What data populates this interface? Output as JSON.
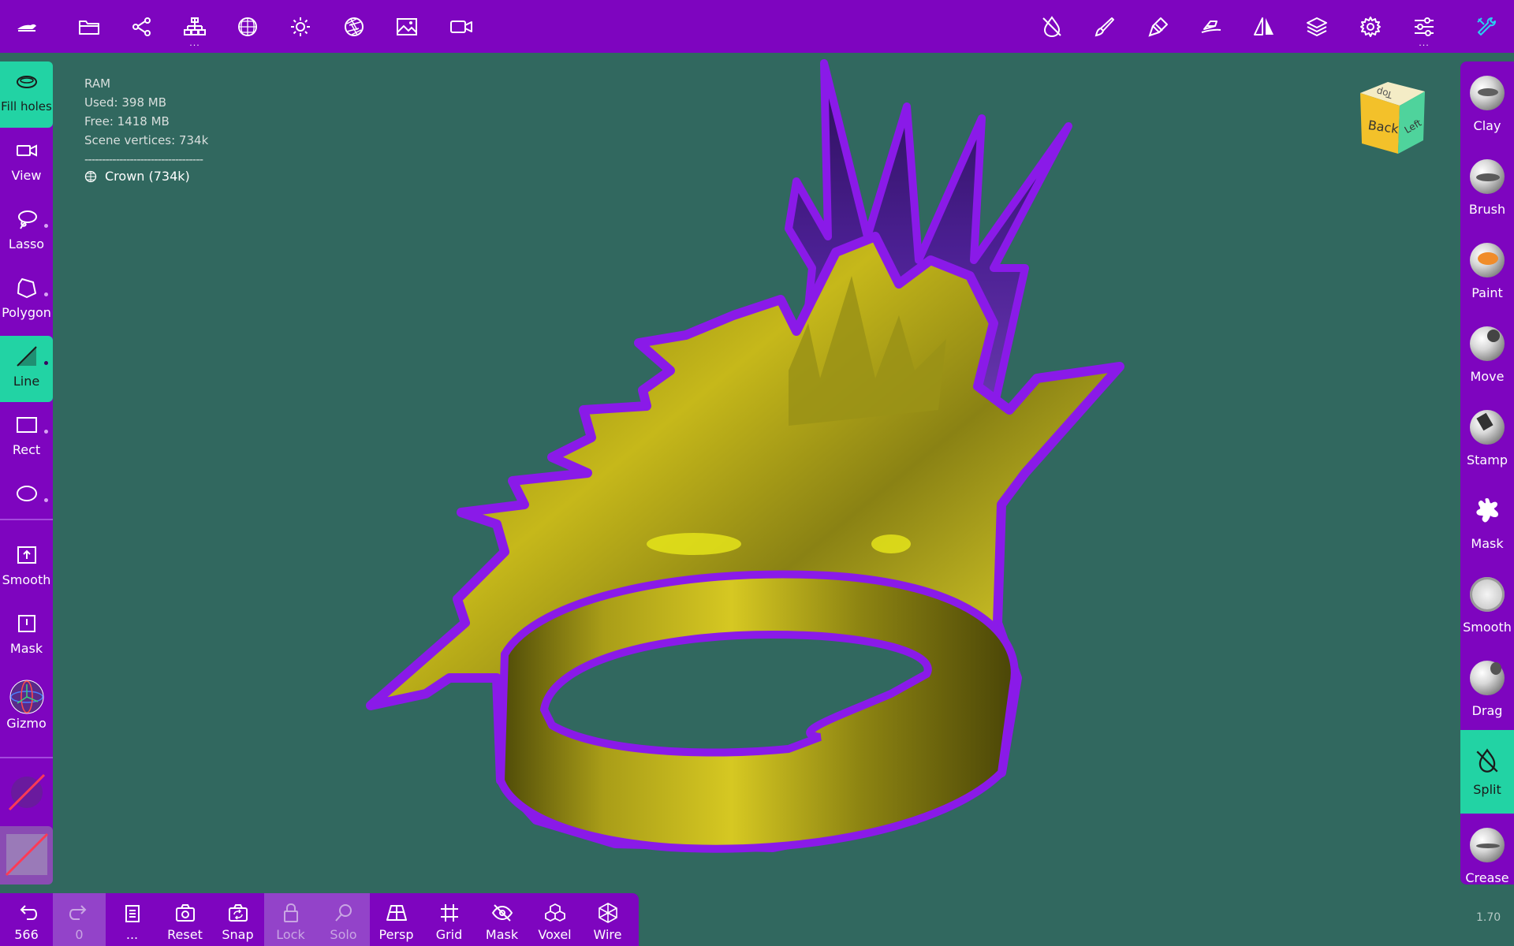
{
  "colors": {
    "accent_purple": "#7e05bf",
    "active_green": "#22d3a4",
    "viewport_bg": "#31685f",
    "mesh_gold": "#b3a318",
    "outline": "#8a1ae8"
  },
  "topbar": {
    "left_icons": [
      "app-logo-icon",
      "folder-icon",
      "share-icon",
      "scene-tree-icon",
      "sphere-grid-icon",
      "light-icon",
      "aperture-icon",
      "image-icon",
      "video-camera-icon"
    ],
    "right_icons": [
      "no-symmetry-icon",
      "brush-icon",
      "stroke-icon",
      "tools-icon",
      "mirror-icon",
      "layers-icon",
      "settings-icon",
      "sliders-icon",
      "wrench-icon"
    ],
    "dots": "..."
  },
  "left_sidebar": {
    "items": [
      {
        "label": "Fill holes",
        "icon": "ellipse-icon",
        "active": true
      },
      {
        "label": "View",
        "icon": "video-camera-icon",
        "active": false
      },
      {
        "label": "Lasso",
        "icon": "lasso-icon",
        "active": false
      },
      {
        "label": "Polygon",
        "icon": "polygon-icon",
        "active": false
      },
      {
        "label": "Line",
        "icon": "line-icon",
        "active": true
      },
      {
        "label": "Rect",
        "icon": "rectangle-icon",
        "active": false
      },
      {
        "label": "",
        "icon": "ellipse-shape-icon",
        "active": false
      }
    ],
    "smooth_label": "Smooth",
    "mask_label": "Mask",
    "gizmo_label": "Gizmo"
  },
  "right_sidebar": {
    "items": [
      {
        "label": "Clay",
        "icon": "clay-sphere-icon"
      },
      {
        "label": "Brush",
        "icon": "brush-sphere-icon"
      },
      {
        "label": "Paint",
        "icon": "paint-sphere-icon"
      },
      {
        "label": "Move",
        "icon": "move-sphere-icon"
      },
      {
        "label": "Stamp",
        "icon": "stamp-sphere-icon"
      },
      {
        "label": "Mask",
        "icon": "mask-splat-icon"
      },
      {
        "label": "Smooth",
        "icon": "smooth-sphere-icon"
      },
      {
        "label": "Drag",
        "icon": "drag-sphere-icon"
      },
      {
        "label": "Split",
        "icon": "split-icon",
        "active": true
      },
      {
        "label": "Crease",
        "icon": "crease-sphere-icon"
      }
    ]
  },
  "bottombar": {
    "undo": {
      "label": "566",
      "icon": "undo-icon"
    },
    "redo": {
      "label": "0",
      "icon": "redo-icon"
    },
    "more": {
      "label": "...",
      "icon": "document-icon"
    },
    "buttons": [
      {
        "label": "Reset",
        "icon": "camera-reset-icon"
      },
      {
        "label": "Snap",
        "icon": "camera-snap-icon"
      },
      {
        "label": "Lock",
        "icon": "lock-icon",
        "dim": true
      },
      {
        "label": "Solo",
        "icon": "search-icon",
        "dim": true
      },
      {
        "label": "Persp",
        "icon": "perspective-icon"
      },
      {
        "label": "Grid",
        "icon": "grid-icon"
      },
      {
        "label": "Mask",
        "icon": "eye-slash-icon"
      },
      {
        "label": "Voxel",
        "icon": "voxel-icon"
      },
      {
        "label": "Wire",
        "icon": "wireframe-icon"
      }
    ]
  },
  "info": {
    "ram_title": "RAM",
    "used": "Used: 398 MB",
    "free": "Free: 1418 MB",
    "vertices": "Scene vertices: 734k",
    "separator": "----------------------------------",
    "scene_object": "Crown (734k)"
  },
  "navcube": {
    "top": "Top",
    "front": "Back",
    "side": "Left"
  },
  "version": "1.70"
}
